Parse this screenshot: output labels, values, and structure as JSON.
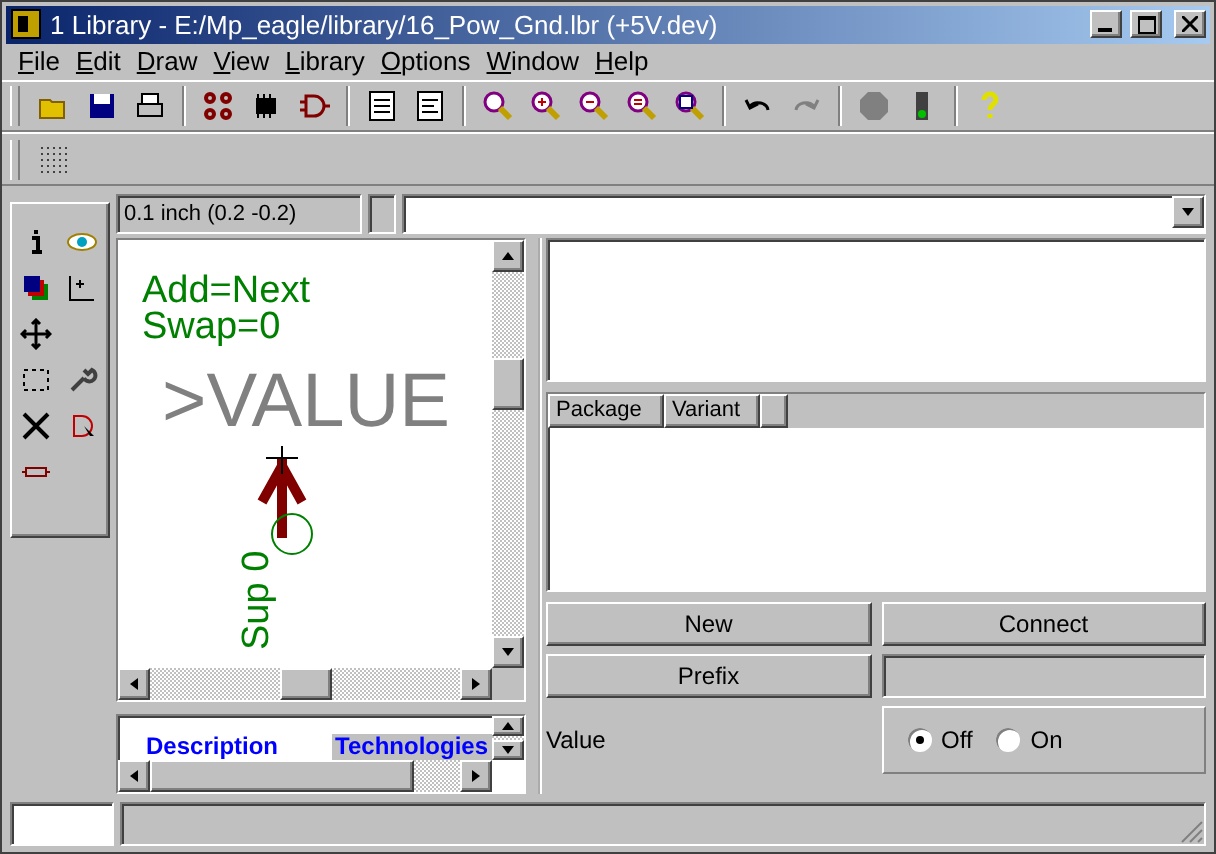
{
  "window": {
    "title": "1 Library - E:/Mp_eagle/library/16_Pow_Gnd.lbr (+5V.dev)"
  },
  "menu": [
    "File",
    "Edit",
    "Draw",
    "View",
    "Library",
    "Options",
    "Window",
    "Help"
  ],
  "coordinates": "0.1 inch (0.2 -0.2)",
  "canvas": {
    "texts": [
      {
        "kind": "label",
        "text": "Add=Next"
      },
      {
        "kind": "label",
        "text": "Swap=0"
      },
      {
        "kind": "value",
        "text": ">VALUE"
      },
      {
        "kind": "pin",
        "text": "Sup 0"
      }
    ]
  },
  "info_tabs": [
    {
      "label": "Description",
      "selected": false
    },
    {
      "label": "Technologies",
      "selected": true
    }
  ],
  "table": {
    "columns": [
      "Package",
      "Variant"
    ]
  },
  "buttons": {
    "new": "New",
    "connect": "Connect",
    "prefix": "Prefix"
  },
  "value": {
    "label": "Value",
    "options": [
      {
        "label": "Off",
        "selected": true
      },
      {
        "label": "On",
        "selected": false
      }
    ]
  }
}
